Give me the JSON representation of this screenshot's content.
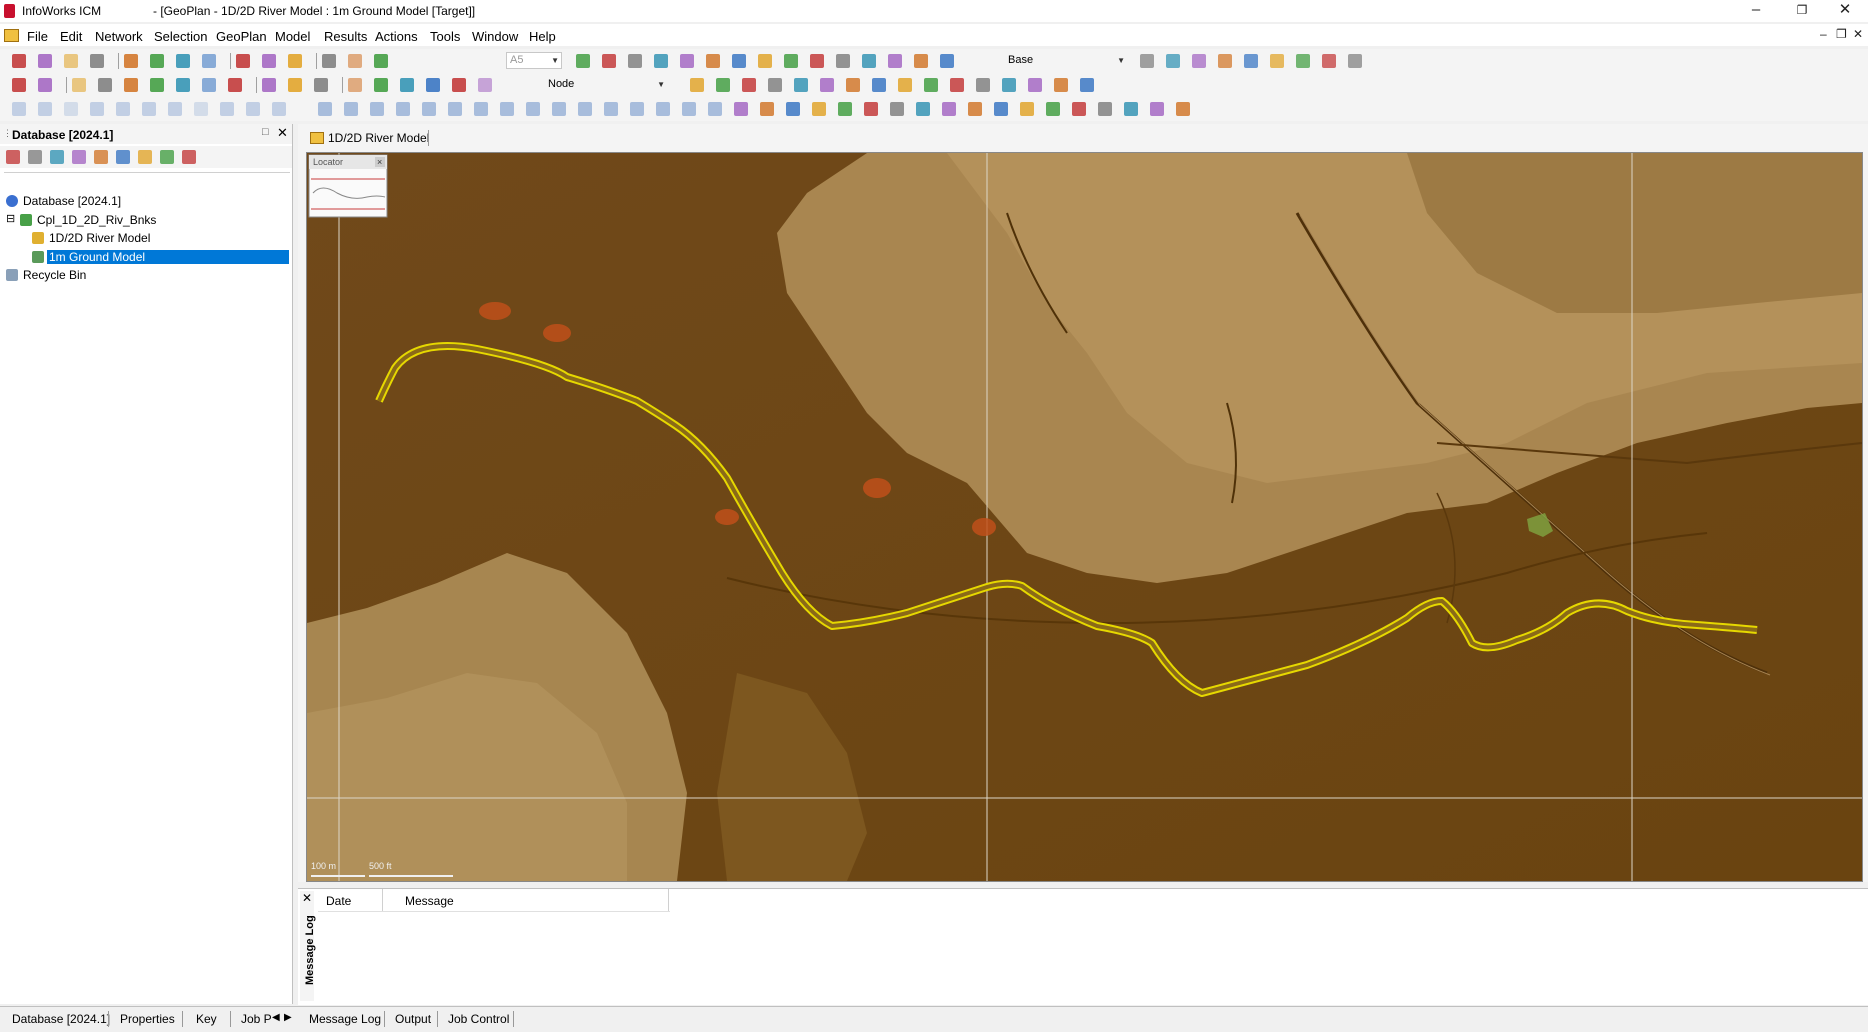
{
  "window": {
    "app_name": "InfoWorks ICM",
    "document_title": "- [GeoPlan - 1D/2D River Model : 1m Ground Model  [Target]]"
  },
  "menu": [
    "File",
    "Edit",
    "Network",
    "Selection",
    "GeoPlan",
    "Model",
    "Results",
    "Actions",
    "Tools",
    "Window",
    "Help"
  ],
  "toolbar": {
    "combo_scale_value": "A5",
    "combo_base_value": "Base",
    "combo_node_value": "Node"
  },
  "database_panel": {
    "title": "Database [2024.1]",
    "tree": [
      {
        "label": "Database [2024.1]",
        "level": 0,
        "icon": "database-icon"
      },
      {
        "label": "Cpl_1D_2D_Riv_Bnks",
        "level": 1,
        "icon": "model-group-icon"
      },
      {
        "label": "1D/2D River Model",
        "level": 2,
        "icon": "network-icon"
      },
      {
        "label": "1m Ground Model",
        "level": 2,
        "icon": "ground-model-icon",
        "selected": true
      },
      {
        "label": "Recycle Bin",
        "level": 0,
        "icon": "recycle-bin-icon"
      }
    ]
  },
  "map_view": {
    "tab_label": "1D/2D River Model",
    "locator_label": "Locator",
    "scalebar_metric": "100 m",
    "scalebar_imperial": "500 ft"
  },
  "message_log": {
    "side_label": "Message Log",
    "columns": [
      "Date",
      "Message"
    ]
  },
  "bottom_tabs_left": [
    "Database [2024.1]",
    "Properties",
    "Key",
    "Job P"
  ],
  "bottom_tabs_right": [
    "Message Log",
    "Output",
    "Job Control"
  ],
  "colors": {
    "selection": "#0078d7",
    "river_line": "#e6d800",
    "terrain_dark": "#6e4810",
    "terrain_light": "#b08a50"
  }
}
